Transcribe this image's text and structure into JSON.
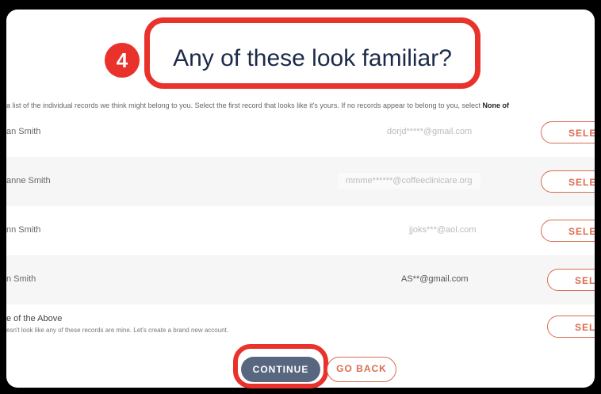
{
  "step_badge": "4",
  "title": "Any of these look familiar?",
  "intro": {
    "text": "a list of the individual records we think might belong to you. Select the first record that looks like it's yours. If no records appear to belong to you, select ",
    "emphasis": "None of"
  },
  "records": [
    {
      "name": "an Smith",
      "email": "dorjd*****@gmail.com",
      "select": "SELEC"
    },
    {
      "name": "anne Smith",
      "email": "mmme******@coffeeclinicare.org",
      "select": "SELEC"
    },
    {
      "name": "nn Smith",
      "email": "jjoks***@aol.com",
      "select": "SELEC"
    },
    {
      "name": "n Smith",
      "email": "AS**@gmail.com",
      "select": "SELE"
    }
  ],
  "none_option": {
    "title": "e of the Above",
    "subtitle": "esn't look like any of these records are mine. Let's create a brand new account.",
    "select": "SELE"
  },
  "actions": {
    "continue": "CONTINUE",
    "go_back": "GO BACK"
  },
  "colors": {
    "accent": "#d96b4e",
    "highlight": "#e8322b",
    "primary_button": "#58677f",
    "title_text": "#1c2a4a"
  }
}
